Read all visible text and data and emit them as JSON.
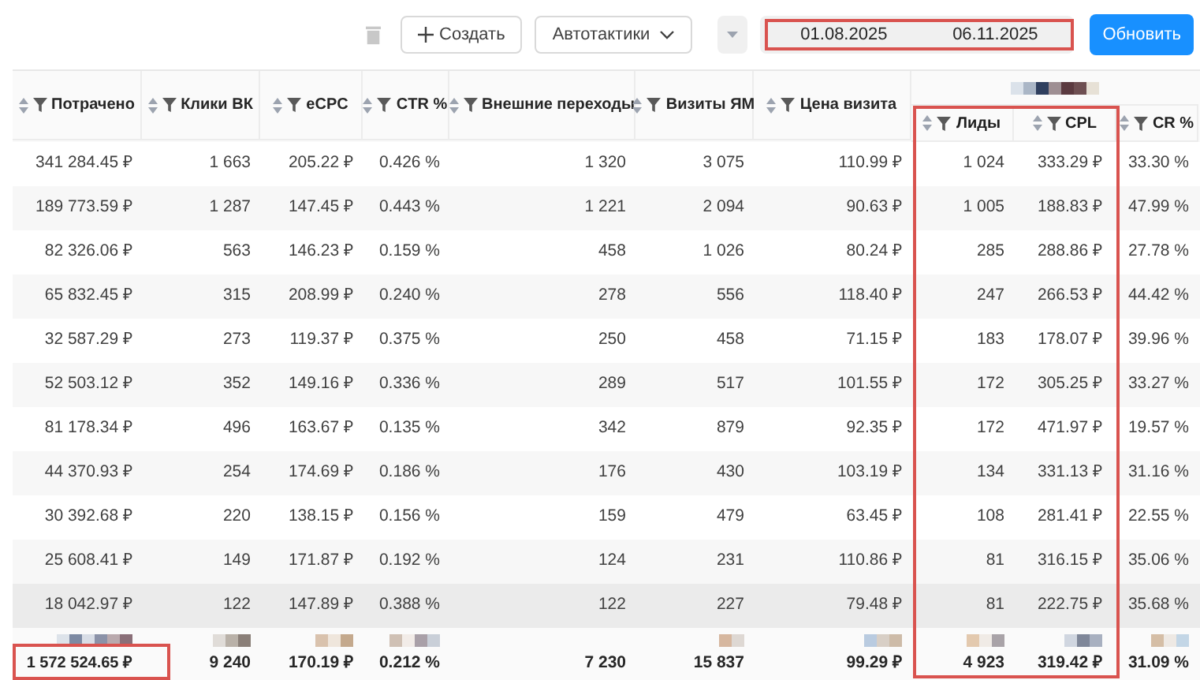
{
  "toolbar": {
    "create_label": "Создать",
    "tactics_label": "Автотактики",
    "date_from": "01.08.2025",
    "date_to": "06.11.2025",
    "refresh_label": "Обновить"
  },
  "table": {
    "columns": [
      {
        "label": "Потрачено",
        "grouped": false
      },
      {
        "label": "Клики ВК",
        "grouped": false
      },
      {
        "label": "eCPC",
        "grouped": false
      },
      {
        "label": "CTR %",
        "grouped": false
      },
      {
        "label": "Внешние переходы",
        "grouped": false
      },
      {
        "label": "Визиты ЯМ",
        "grouped": false
      },
      {
        "label": "Цена визита",
        "grouped": false
      },
      {
        "label": "Лиды",
        "grouped": true
      },
      {
        "label": "CPL",
        "grouped": true
      },
      {
        "label": "CR %",
        "grouped": true
      }
    ],
    "rows": [
      {
        "cells": [
          "341 284.45 ₽",
          "1 663",
          "205.22 ₽",
          "0.426 %",
          "1 320",
          "3 075",
          "110.99 ₽",
          "1 024",
          "333.29 ₽",
          "33.30 %"
        ],
        "hovered": false
      },
      {
        "cells": [
          "189 773.59 ₽",
          "1 287",
          "147.45 ₽",
          "0.443 %",
          "1 221",
          "2 094",
          "90.63 ₽",
          "1 005",
          "188.83 ₽",
          "47.99 %"
        ],
        "hovered": false
      },
      {
        "cells": [
          "82 326.06 ₽",
          "563",
          "146.23 ₽",
          "0.159 %",
          "458",
          "1 026",
          "80.24 ₽",
          "285",
          "288.86 ₽",
          "27.78 %"
        ],
        "hovered": false
      },
      {
        "cells": [
          "65 832.45 ₽",
          "315",
          "208.99 ₽",
          "0.240 %",
          "278",
          "556",
          "118.40 ₽",
          "247",
          "266.53 ₽",
          "44.42 %"
        ],
        "hovered": false
      },
      {
        "cells": [
          "32 587.29 ₽",
          "273",
          "119.37 ₽",
          "0.375 %",
          "250",
          "458",
          "71.15 ₽",
          "183",
          "178.07 ₽",
          "39.96 %"
        ],
        "hovered": false
      },
      {
        "cells": [
          "52 503.12 ₽",
          "352",
          "149.16 ₽",
          "0.336 %",
          "289",
          "517",
          "101.55 ₽",
          "172",
          "305.25 ₽",
          "33.27 %"
        ],
        "hovered": false
      },
      {
        "cells": [
          "81 178.34 ₽",
          "496",
          "163.67 ₽",
          "0.135 %",
          "342",
          "879",
          "92.35 ₽",
          "172",
          "471.97 ₽",
          "19.57 %"
        ],
        "hovered": false
      },
      {
        "cells": [
          "44 370.93 ₽",
          "254",
          "174.69 ₽",
          "0.186 %",
          "176",
          "430",
          "103.19 ₽",
          "134",
          "331.13 ₽",
          "31.16 %"
        ],
        "hovered": false
      },
      {
        "cells": [
          "30 392.68 ₽",
          "220",
          "138.15 ₽",
          "0.156 %",
          "159",
          "479",
          "63.45 ₽",
          "108",
          "281.41 ₽",
          "22.55 %"
        ],
        "hovered": false
      },
      {
        "cells": [
          "25 608.41 ₽",
          "149",
          "171.87 ₽",
          "0.192 %",
          "124",
          "231",
          "110.86 ₽",
          "81",
          "316.15 ₽",
          "35.06 %"
        ],
        "hovered": false
      },
      {
        "cells": [
          "18 042.97 ₽",
          "122",
          "147.89 ₽",
          "0.388 %",
          "122",
          "227",
          "79.48 ₽",
          "81",
          "222.75 ₽",
          "35.68 %"
        ],
        "hovered": true
      }
    ],
    "totals": [
      "1 572 524.65 ₽",
      "9 240",
      "170.19 ₽",
      "0.212 %",
      "7 230",
      "15 837",
      "99.29 ₽",
      "4 923",
      "319.42 ₽",
      "31.09 %"
    ]
  }
}
